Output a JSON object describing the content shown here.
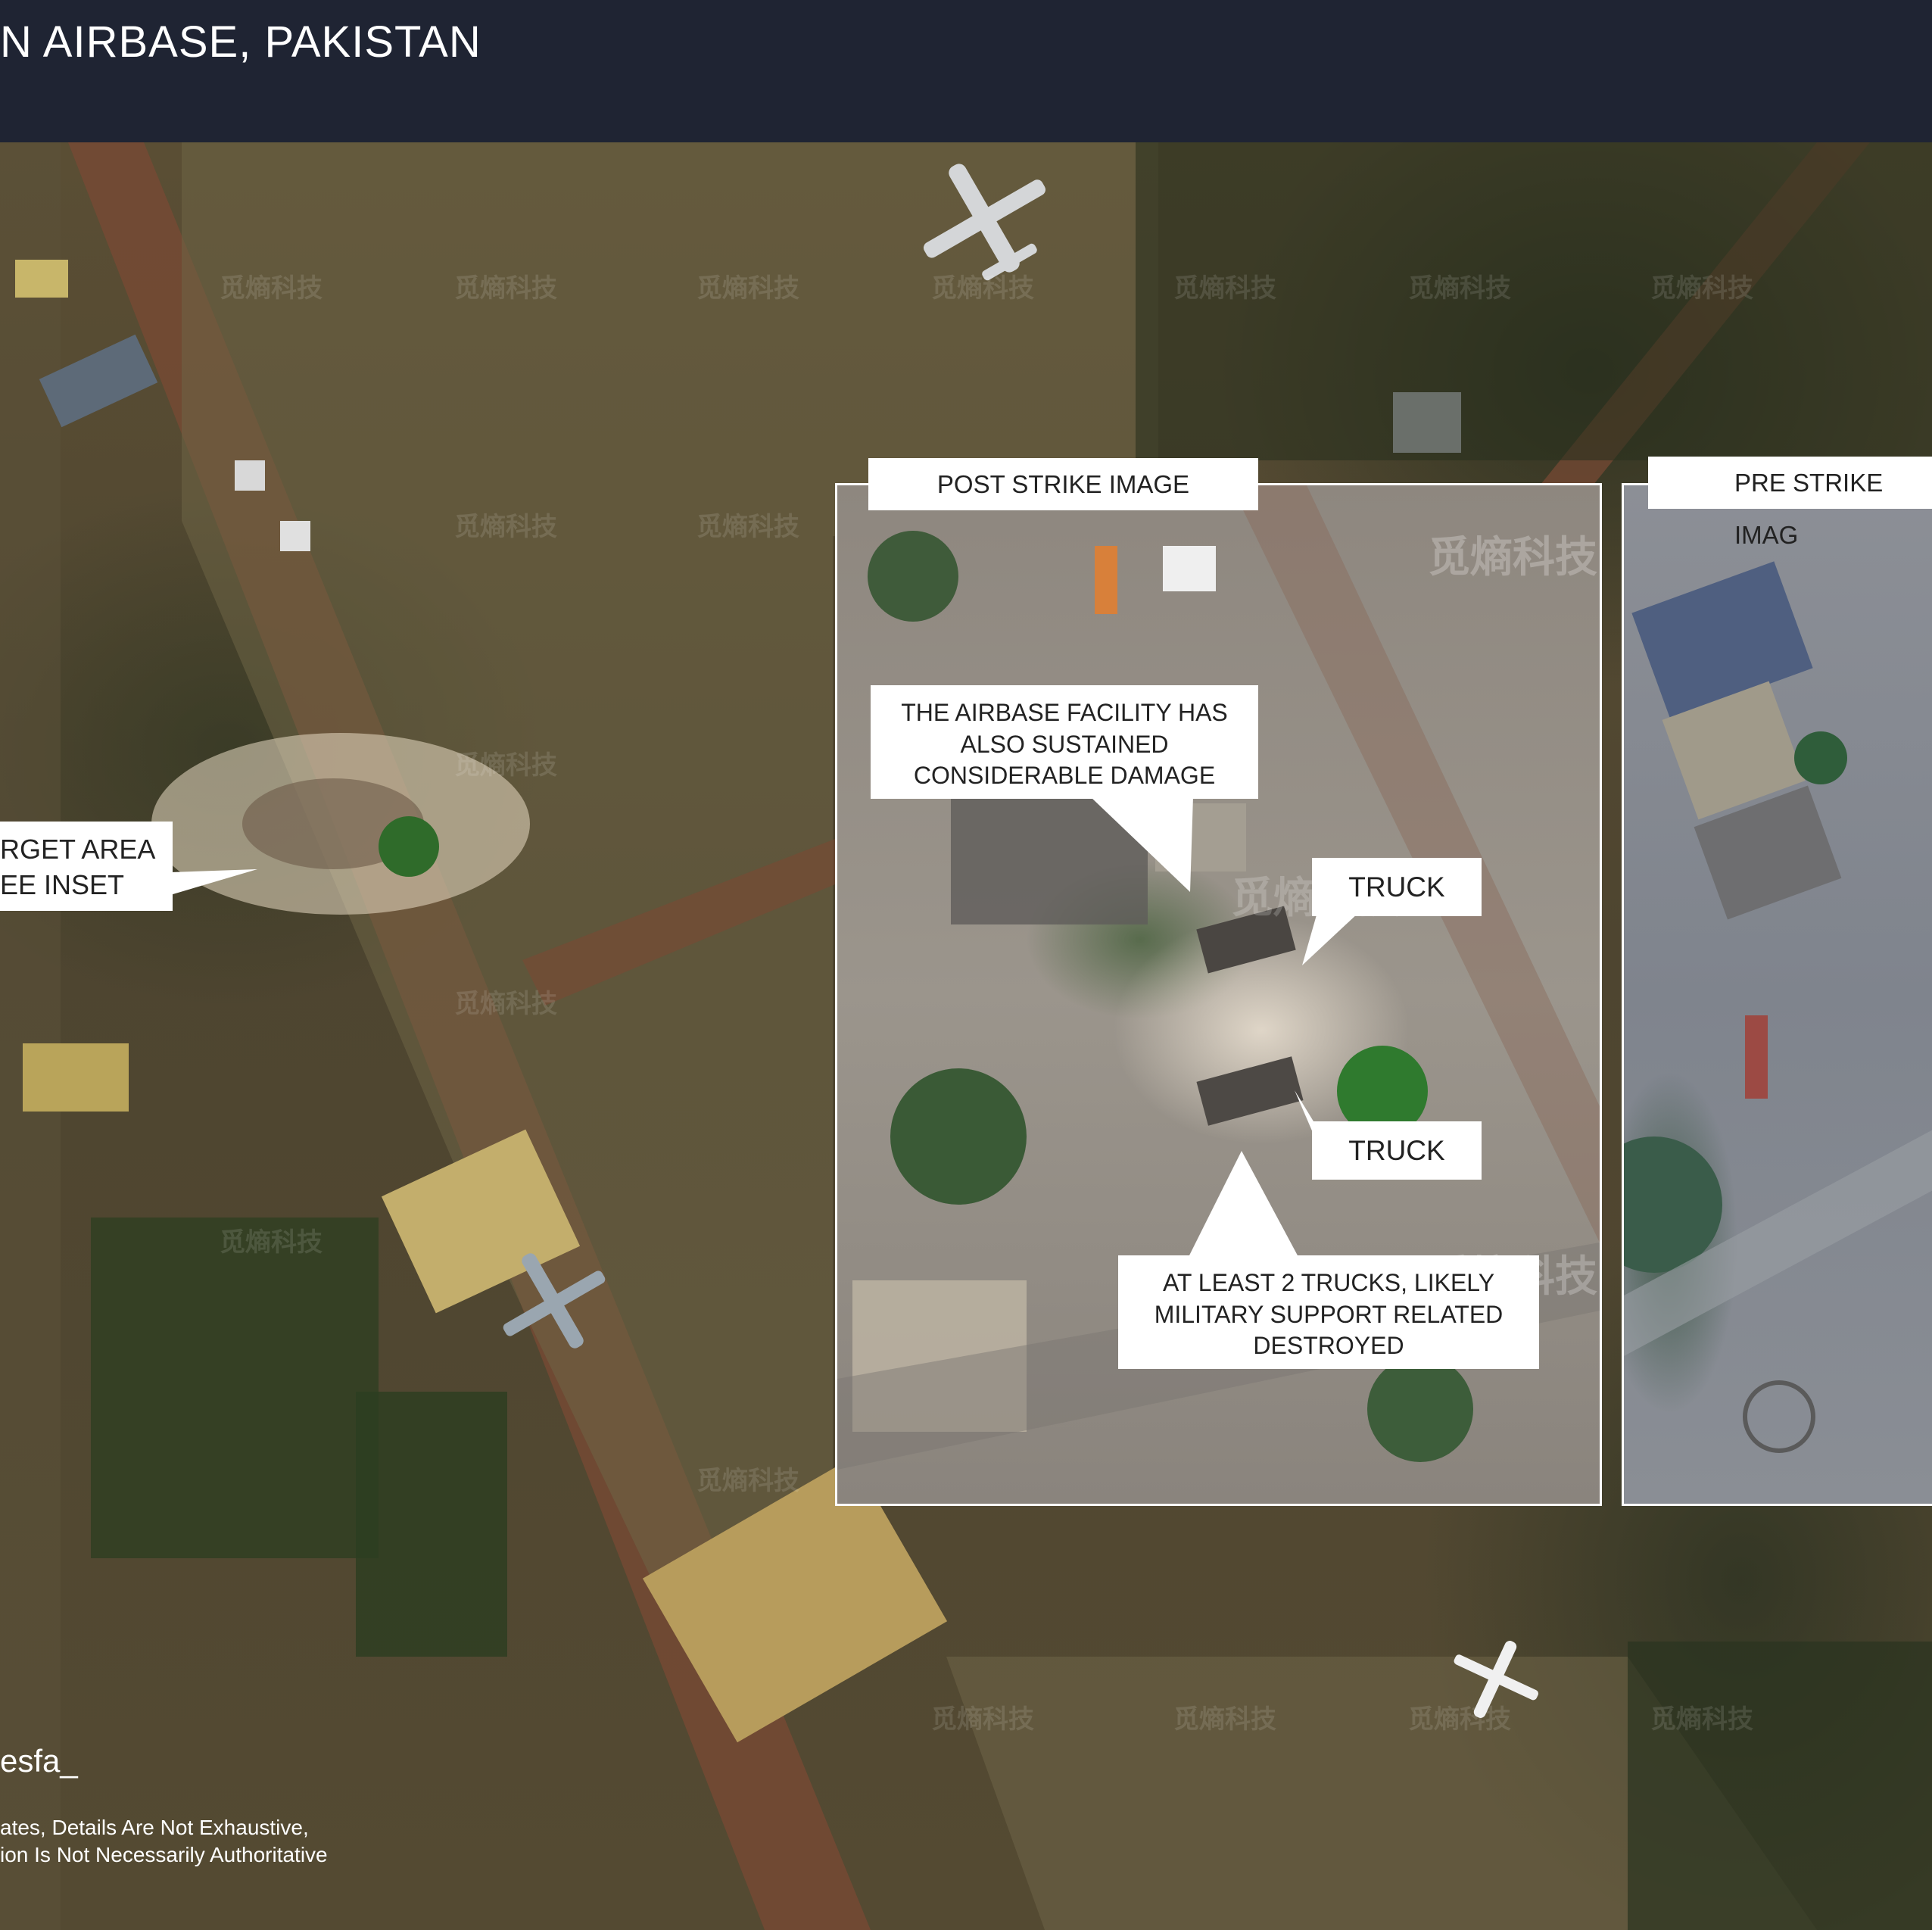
{
  "header": {
    "title": "N AIRBASE, PAKISTAN"
  },
  "watermark": "觅熵科技",
  "insets": {
    "post_label": "POST STRIKE IMAGE",
    "pre_label": "PRE STRIKE IMAG"
  },
  "annotations": {
    "target_area": [
      "RGET AREA",
      "EE INSET"
    ],
    "damage": [
      "THE AIRBASE FACILITY HAS",
      "ALSO SUSTAINED",
      "CONSIDERABLE DAMAGE"
    ],
    "truck_1": "TRUCK",
    "truck_2": "TRUCK",
    "trucks_destroyed": [
      "AT LEAST 2 TRUCKS, LIKELY",
      "MILITARY SUPPORT RELATED",
      "DESTROYED"
    ]
  },
  "footer": {
    "credit": "esfa_",
    "disclaimer": [
      "ates, Details Are Not Exhaustive,",
      "ion Is Not Necessarily Authoritative"
    ]
  },
  "colors": {
    "header_bg": "#1f2433",
    "label_bg": "#ffffff",
    "label_text": "#222222"
  }
}
